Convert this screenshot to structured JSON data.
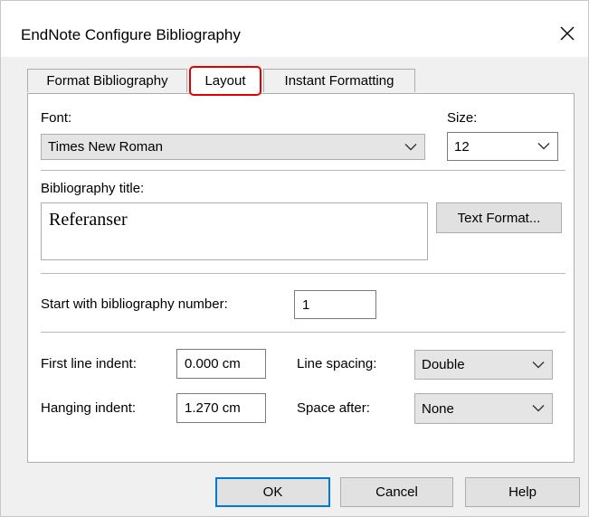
{
  "window": {
    "title": "EndNote Configure Bibliography",
    "close_glyph": "✕"
  },
  "tabs": [
    {
      "label": "Format Bibliography",
      "active": false
    },
    {
      "label": "Layout",
      "active": true
    },
    {
      "label": "Instant Formatting",
      "active": false
    }
  ],
  "layout": {
    "font": {
      "label": "Font:",
      "value": "Times New Roman"
    },
    "size": {
      "label": "Size:",
      "value": "12"
    },
    "bibliography_title": {
      "label": "Bibliography title:",
      "value": "Referanser"
    },
    "text_format_button": "Text Format...",
    "start_number": {
      "label": "Start with bibliography number:",
      "value": "1"
    },
    "first_line_indent": {
      "label": "First line indent:",
      "value": "0.000 cm"
    },
    "hanging_indent": {
      "label": "Hanging indent:",
      "value": "1.270 cm"
    },
    "line_spacing": {
      "label": "Line spacing:",
      "value": "Double"
    },
    "space_after": {
      "label": "Space after:",
      "value": "None"
    }
  },
  "buttons": {
    "ok": "OK",
    "cancel": "Cancel",
    "help": "Help"
  },
  "colors": {
    "highlight_red": "#e00000",
    "default_button_blue": "#0078d7",
    "dialog_bg": "#f0f0f0"
  }
}
